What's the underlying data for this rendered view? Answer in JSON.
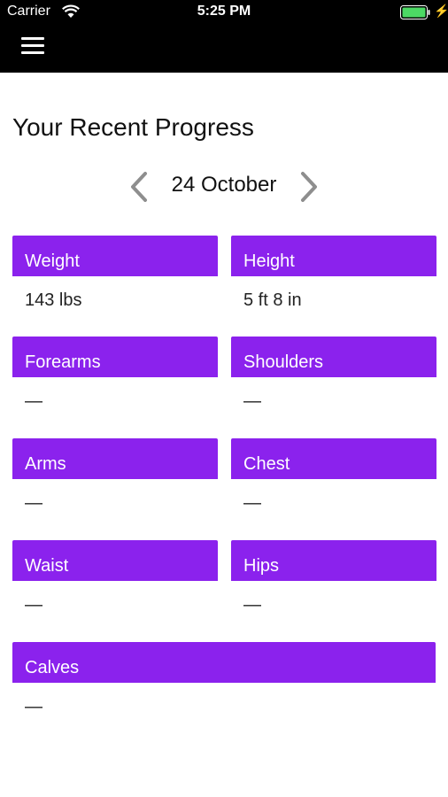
{
  "status": {
    "carrier": "Carrier",
    "time": "5:25 PM"
  },
  "page": {
    "title": "Your Recent Progress",
    "date": "24 October"
  },
  "colors": {
    "accent": "#8b22ed",
    "topbar": "#000000"
  },
  "icons": {
    "menu": "menu-icon",
    "prev": "chevron-left-icon",
    "next": "chevron-right-icon"
  },
  "cards": [
    {
      "label": "Weight",
      "value": "143 lbs"
    },
    {
      "label": "Height",
      "value": "5 ft 8 in"
    },
    {
      "label": "Forearms",
      "value": "—"
    },
    {
      "label": "Shoulders",
      "value": "—"
    },
    {
      "label": "Arms",
      "value": "—"
    },
    {
      "label": "Chest",
      "value": "—"
    },
    {
      "label": "Waist",
      "value": "—"
    },
    {
      "label": "Hips",
      "value": "—"
    },
    {
      "label": "Calves",
      "value": "—"
    }
  ]
}
